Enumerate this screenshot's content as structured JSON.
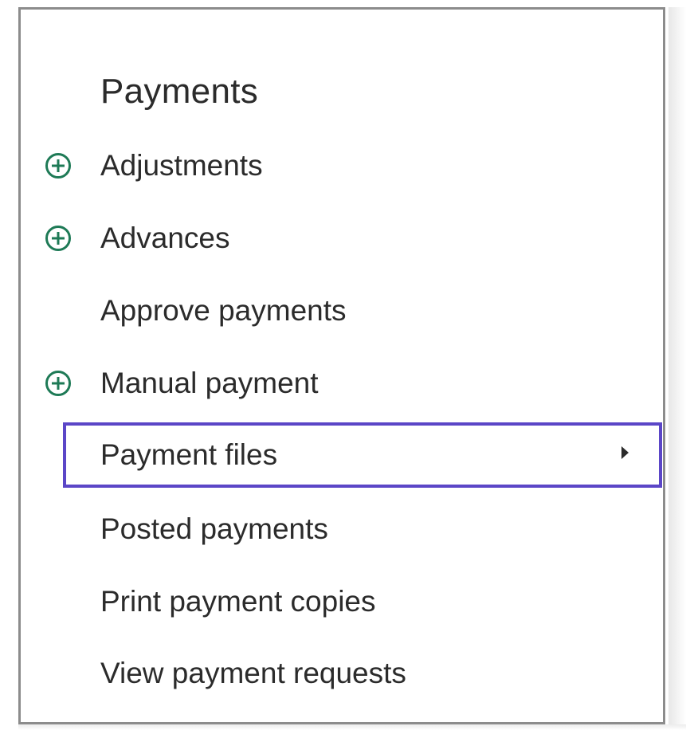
{
  "panel": {
    "title": "Payments",
    "accent_color": "#1e7a56",
    "focus_color": "#5b46c7"
  },
  "menu": {
    "items": [
      {
        "label": "Adjustments",
        "icon": "add-circle-icon"
      },
      {
        "label": "Advances",
        "icon": "add-circle-icon"
      },
      {
        "label": "Approve payments",
        "icon": ""
      },
      {
        "label": "Manual payment",
        "icon": "add-circle-icon"
      },
      {
        "label": "Payment files",
        "icon": "chevron-right-icon",
        "selected": true
      },
      {
        "label": "Posted payments",
        "icon": ""
      },
      {
        "label": "Print payment copies",
        "icon": ""
      },
      {
        "label": "View payment requests",
        "icon": ""
      }
    ]
  }
}
